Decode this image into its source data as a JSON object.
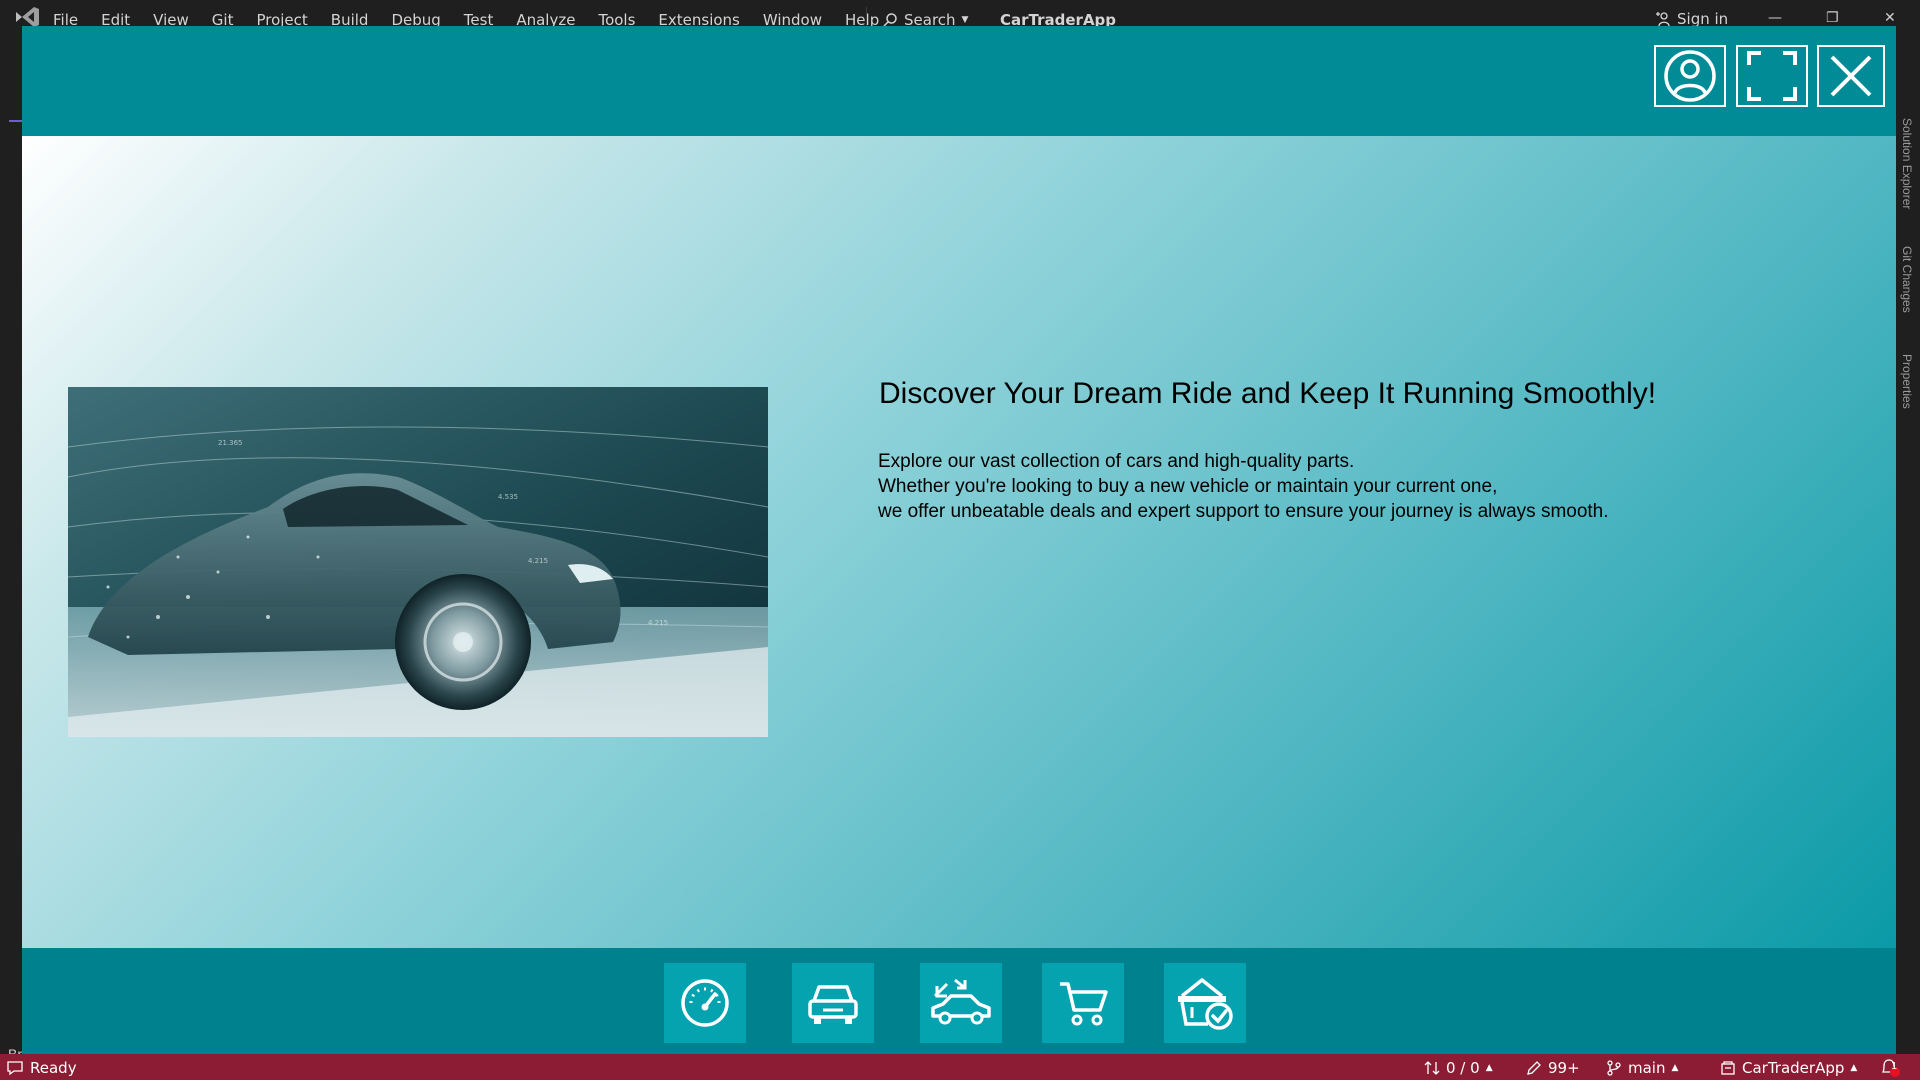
{
  "ide": {
    "menu": [
      "File",
      "Edit",
      "View",
      "Git",
      "Project",
      "Build",
      "Debug",
      "Test",
      "Analyze",
      "Tools",
      "Extensions",
      "Window",
      "Help"
    ],
    "search_label": "Search",
    "solution_title": "CarTraderApp",
    "sign_in_label": "Sign in",
    "left_strip_text": "Br",
    "right_tabs": [
      "Solution Explorer",
      "Git Changes",
      "Properties"
    ],
    "status": {
      "ready": "Ready",
      "line_changes": "0 / 0",
      "edits": "99+",
      "branch": "main",
      "repo": "CarTraderApp",
      "notification_count": "1"
    },
    "colors": {
      "statusbar": "#8b1c33",
      "shell": "#1f1f1f"
    }
  },
  "app": {
    "header_buttons": [
      {
        "name": "profile",
        "icon": "user-circle-icon"
      },
      {
        "name": "fullscreen",
        "icon": "fullscreen-icon"
      },
      {
        "name": "close",
        "icon": "close-icon"
      }
    ],
    "hero": {
      "image_alt": "sports car with digital data streams",
      "headline": "Discover Your Dream Ride and Keep It Running Smoothly!",
      "body": [
        "Explore our vast collection of cars and high-quality parts.",
        "Whether you're looking to buy a new vehicle or maintain your current one,",
        "we offer unbeatable deals and expert support to ensure your journey is always smooth."
      ]
    },
    "footer_buttons": [
      {
        "name": "dashboard",
        "icon": "speedometer-icon"
      },
      {
        "name": "cars",
        "icon": "car-front-icon"
      },
      {
        "name": "trade",
        "icon": "car-trade-icon"
      },
      {
        "name": "cart",
        "icon": "shopping-cart-icon"
      },
      {
        "name": "orders",
        "icon": "basket-check-icon"
      }
    ],
    "colors": {
      "header": "#008b96",
      "footer": "#00828e",
      "footer_button": "#05a2b0",
      "accent": "#0b9aa7"
    }
  }
}
